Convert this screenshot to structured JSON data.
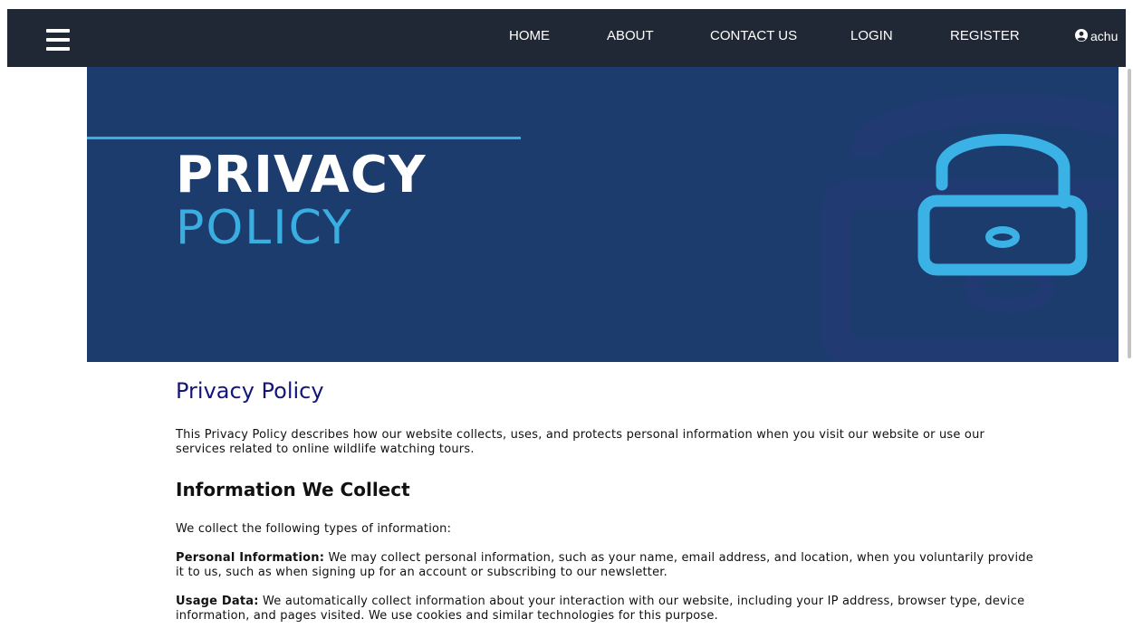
{
  "nav": {
    "menu_icon": "hamburger-menu-icon",
    "links": [
      "HOME",
      "ABOUT",
      "CONTACT US",
      "LOGIN",
      "REGISTER"
    ],
    "user_icon": "user-circle-icon",
    "user_name": "achu"
  },
  "hero": {
    "title_line1": "PRIVACY",
    "title_line2": "POLICY",
    "icon": "padlock-icon",
    "colors": {
      "background": "#1b3c6c",
      "accent": "#3aaee1",
      "title": "#ffffff"
    }
  },
  "content": {
    "title": "Privacy Policy",
    "intro": "This Privacy Policy describes how our website collects, uses, and protects personal information when you visit our website or use our services related to online wildlife watching tours.",
    "section_heading": "Information We Collect",
    "types_intro": "We collect the following types of information:",
    "personal": {
      "label": "Personal Information:",
      "text": " We may collect personal information, such as your name, email address, and location, when you voluntarily provide it to us, such as when signing up for an account or subscribing to our newsletter."
    },
    "usage": {
      "label": "Usage Data:",
      "text": " We automatically collect information about your interaction with our website, including your IP address, browser type, device information, and pages visited. We use cookies and similar technologies for this purpose."
    }
  },
  "colors": {
    "nav_bg": "#212835",
    "heading_title": "#14157a"
  }
}
